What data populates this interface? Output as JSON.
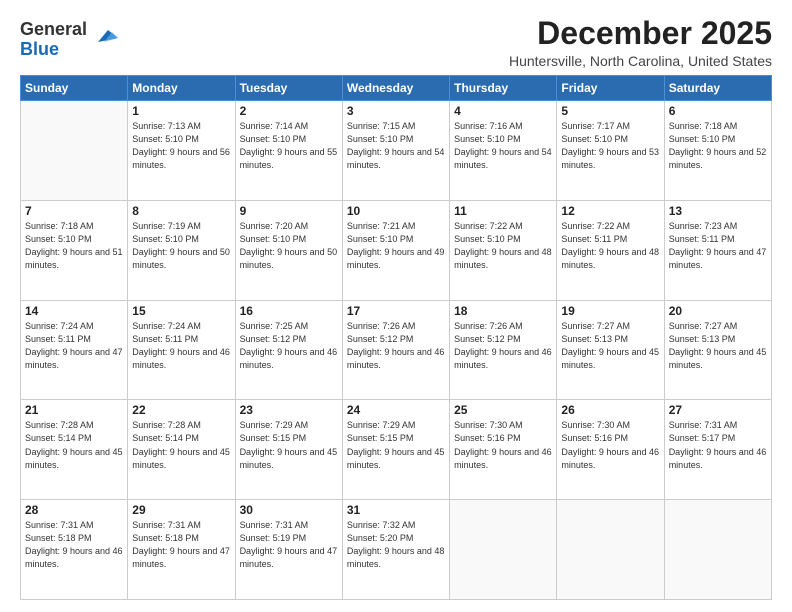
{
  "logo": {
    "general": "General",
    "blue": "Blue"
  },
  "header": {
    "month_title": "December 2025",
    "subtitle": "Huntersville, North Carolina, United States"
  },
  "days_of_week": [
    "Sunday",
    "Monday",
    "Tuesday",
    "Wednesday",
    "Thursday",
    "Friday",
    "Saturday"
  ],
  "weeks": [
    [
      {
        "day": "",
        "sunrise": "",
        "sunset": "",
        "daylight": "",
        "empty": true
      },
      {
        "day": "1",
        "sunrise": "Sunrise: 7:13 AM",
        "sunset": "Sunset: 5:10 PM",
        "daylight": "Daylight: 9 hours and 56 minutes."
      },
      {
        "day": "2",
        "sunrise": "Sunrise: 7:14 AM",
        "sunset": "Sunset: 5:10 PM",
        "daylight": "Daylight: 9 hours and 55 minutes."
      },
      {
        "day": "3",
        "sunrise": "Sunrise: 7:15 AM",
        "sunset": "Sunset: 5:10 PM",
        "daylight": "Daylight: 9 hours and 54 minutes."
      },
      {
        "day": "4",
        "sunrise": "Sunrise: 7:16 AM",
        "sunset": "Sunset: 5:10 PM",
        "daylight": "Daylight: 9 hours and 54 minutes."
      },
      {
        "day": "5",
        "sunrise": "Sunrise: 7:17 AM",
        "sunset": "Sunset: 5:10 PM",
        "daylight": "Daylight: 9 hours and 53 minutes."
      },
      {
        "day": "6",
        "sunrise": "Sunrise: 7:18 AM",
        "sunset": "Sunset: 5:10 PM",
        "daylight": "Daylight: 9 hours and 52 minutes."
      }
    ],
    [
      {
        "day": "7",
        "sunrise": "Sunrise: 7:18 AM",
        "sunset": "Sunset: 5:10 PM",
        "daylight": "Daylight: 9 hours and 51 minutes."
      },
      {
        "day": "8",
        "sunrise": "Sunrise: 7:19 AM",
        "sunset": "Sunset: 5:10 PM",
        "daylight": "Daylight: 9 hours and 50 minutes."
      },
      {
        "day": "9",
        "sunrise": "Sunrise: 7:20 AM",
        "sunset": "Sunset: 5:10 PM",
        "daylight": "Daylight: 9 hours and 50 minutes."
      },
      {
        "day": "10",
        "sunrise": "Sunrise: 7:21 AM",
        "sunset": "Sunset: 5:10 PM",
        "daylight": "Daylight: 9 hours and 49 minutes."
      },
      {
        "day": "11",
        "sunrise": "Sunrise: 7:22 AM",
        "sunset": "Sunset: 5:10 PM",
        "daylight": "Daylight: 9 hours and 48 minutes."
      },
      {
        "day": "12",
        "sunrise": "Sunrise: 7:22 AM",
        "sunset": "Sunset: 5:11 PM",
        "daylight": "Daylight: 9 hours and 48 minutes."
      },
      {
        "day": "13",
        "sunrise": "Sunrise: 7:23 AM",
        "sunset": "Sunset: 5:11 PM",
        "daylight": "Daylight: 9 hours and 47 minutes."
      }
    ],
    [
      {
        "day": "14",
        "sunrise": "Sunrise: 7:24 AM",
        "sunset": "Sunset: 5:11 PM",
        "daylight": "Daylight: 9 hours and 47 minutes."
      },
      {
        "day": "15",
        "sunrise": "Sunrise: 7:24 AM",
        "sunset": "Sunset: 5:11 PM",
        "daylight": "Daylight: 9 hours and 46 minutes."
      },
      {
        "day": "16",
        "sunrise": "Sunrise: 7:25 AM",
        "sunset": "Sunset: 5:12 PM",
        "daylight": "Daylight: 9 hours and 46 minutes."
      },
      {
        "day": "17",
        "sunrise": "Sunrise: 7:26 AM",
        "sunset": "Sunset: 5:12 PM",
        "daylight": "Daylight: 9 hours and 46 minutes."
      },
      {
        "day": "18",
        "sunrise": "Sunrise: 7:26 AM",
        "sunset": "Sunset: 5:12 PM",
        "daylight": "Daylight: 9 hours and 46 minutes."
      },
      {
        "day": "19",
        "sunrise": "Sunrise: 7:27 AM",
        "sunset": "Sunset: 5:13 PM",
        "daylight": "Daylight: 9 hours and 45 minutes."
      },
      {
        "day": "20",
        "sunrise": "Sunrise: 7:27 AM",
        "sunset": "Sunset: 5:13 PM",
        "daylight": "Daylight: 9 hours and 45 minutes."
      }
    ],
    [
      {
        "day": "21",
        "sunrise": "Sunrise: 7:28 AM",
        "sunset": "Sunset: 5:14 PM",
        "daylight": "Daylight: 9 hours and 45 minutes."
      },
      {
        "day": "22",
        "sunrise": "Sunrise: 7:28 AM",
        "sunset": "Sunset: 5:14 PM",
        "daylight": "Daylight: 9 hours and 45 minutes."
      },
      {
        "day": "23",
        "sunrise": "Sunrise: 7:29 AM",
        "sunset": "Sunset: 5:15 PM",
        "daylight": "Daylight: 9 hours and 45 minutes."
      },
      {
        "day": "24",
        "sunrise": "Sunrise: 7:29 AM",
        "sunset": "Sunset: 5:15 PM",
        "daylight": "Daylight: 9 hours and 45 minutes."
      },
      {
        "day": "25",
        "sunrise": "Sunrise: 7:30 AM",
        "sunset": "Sunset: 5:16 PM",
        "daylight": "Daylight: 9 hours and 46 minutes."
      },
      {
        "day": "26",
        "sunrise": "Sunrise: 7:30 AM",
        "sunset": "Sunset: 5:16 PM",
        "daylight": "Daylight: 9 hours and 46 minutes."
      },
      {
        "day": "27",
        "sunrise": "Sunrise: 7:31 AM",
        "sunset": "Sunset: 5:17 PM",
        "daylight": "Daylight: 9 hours and 46 minutes."
      }
    ],
    [
      {
        "day": "28",
        "sunrise": "Sunrise: 7:31 AM",
        "sunset": "Sunset: 5:18 PM",
        "daylight": "Daylight: 9 hours and 46 minutes."
      },
      {
        "day": "29",
        "sunrise": "Sunrise: 7:31 AM",
        "sunset": "Sunset: 5:18 PM",
        "daylight": "Daylight: 9 hours and 47 minutes."
      },
      {
        "day": "30",
        "sunrise": "Sunrise: 7:31 AM",
        "sunset": "Sunset: 5:19 PM",
        "daylight": "Daylight: 9 hours and 47 minutes."
      },
      {
        "day": "31",
        "sunrise": "Sunrise: 7:32 AM",
        "sunset": "Sunset: 5:20 PM",
        "daylight": "Daylight: 9 hours and 48 minutes."
      },
      {
        "day": "",
        "empty": true
      },
      {
        "day": "",
        "empty": true
      },
      {
        "day": "",
        "empty": true
      }
    ]
  ]
}
